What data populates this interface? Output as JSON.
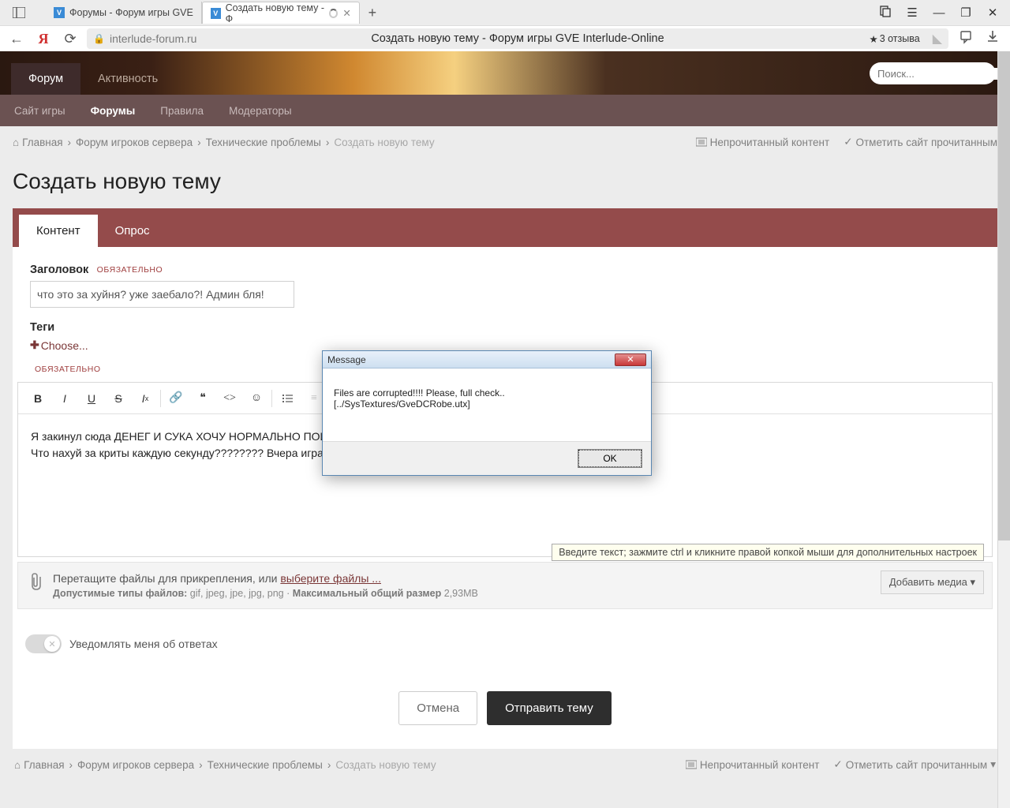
{
  "browser": {
    "tabs": [
      {
        "title": "Форумы - Форум игры GVE"
      },
      {
        "title": "Создать новую тему - Ф"
      }
    ],
    "url": "interlude-forum.ru",
    "page_title": "Создать новую тему - Форум игры GVE Interlude-Online",
    "reviews": "3 отзыва"
  },
  "banner_nav": {
    "forum": "Форум",
    "activity": "Активность"
  },
  "search_placeholder": "Поиск...",
  "sec_nav": {
    "site": "Сайт игры",
    "forums": "Форумы",
    "rules": "Правила",
    "mods": "Модераторы"
  },
  "crumbs": {
    "home": "Главная",
    "c1": "Форум игроков сервера",
    "c2": "Технические проблемы",
    "current": "Создать новую тему",
    "unread": "Непрочитанный контент",
    "mark": "Отметить сайт прочитанным"
  },
  "page_heading": "Создать новую тему",
  "tabs": {
    "content": "Контент",
    "poll": "Опрос"
  },
  "fields": {
    "title_label": "Заголовок",
    "required": "ОБЯЗАТЕЛЬНО",
    "title_value": "что это за хуйня? уже заебало?! Админ бля!",
    "tags_label": "Теги",
    "tags_choose": "Choose..."
  },
  "editor_text_l1": "Я закинул сюда ДЕНЕГ И СУКА ХОЧУ НОРМАЛЬНО ПОИГ",
  "editor_text_l2": "Что нахуй за криты каждую секунду???????? Вчера играл",
  "editor_hint": "Введите текст; зажмите ctrl и кликните правой копкой мыши для дополнительных настроек",
  "attach": {
    "drag": "Перетащите файлы для прикрепления, или ",
    "choose": "выберите файлы ...",
    "sub_label": "Допустимые типы файлов:",
    "sub_types": " gif, jpeg, jpe, jpg, png · ",
    "sub_max_label": "Максимальный общий размер",
    "sub_max": " 2,93МВ",
    "add_media": "Добавить медиа"
  },
  "notify": "Уведомлять меня об ответах",
  "buttons": {
    "cancel": "Отмена",
    "submit": "Отправить тему"
  },
  "dialog": {
    "title": "Message",
    "body": "Files are corrupted!!!! Please, full check.. [../SysTextures/GveDCRobe.utx]",
    "ok": "OK"
  }
}
